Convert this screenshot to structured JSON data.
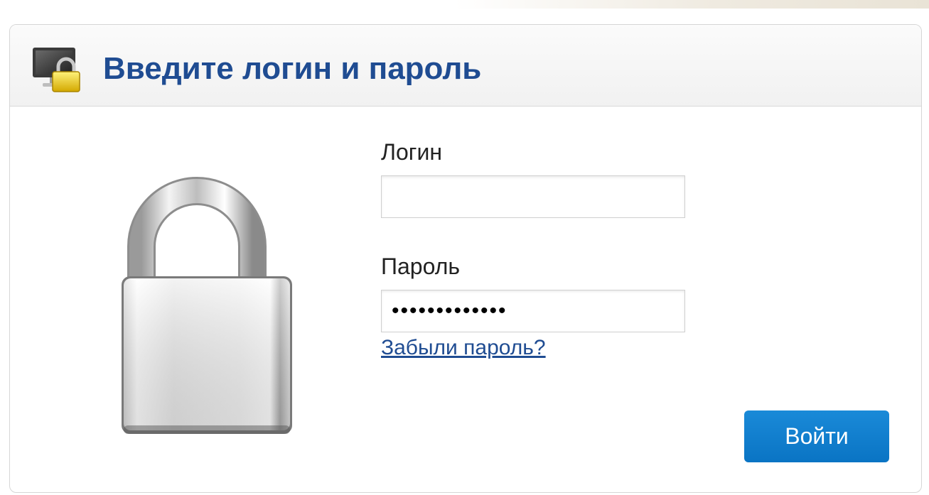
{
  "header": {
    "title": "Введите логин и пароль",
    "icon": "monitor-lock-icon"
  },
  "illustration": {
    "icon": "padlock-open-icon"
  },
  "form": {
    "login_label": "Логин",
    "login_value": "",
    "password_label": "Пароль",
    "password_value": "•••••••••••••",
    "forgot_link": "Забыли пароль?",
    "submit_label": "Войти"
  },
  "colors": {
    "title": "#1f4c92",
    "link": "#1f4c92",
    "button": "#0a74c4"
  }
}
